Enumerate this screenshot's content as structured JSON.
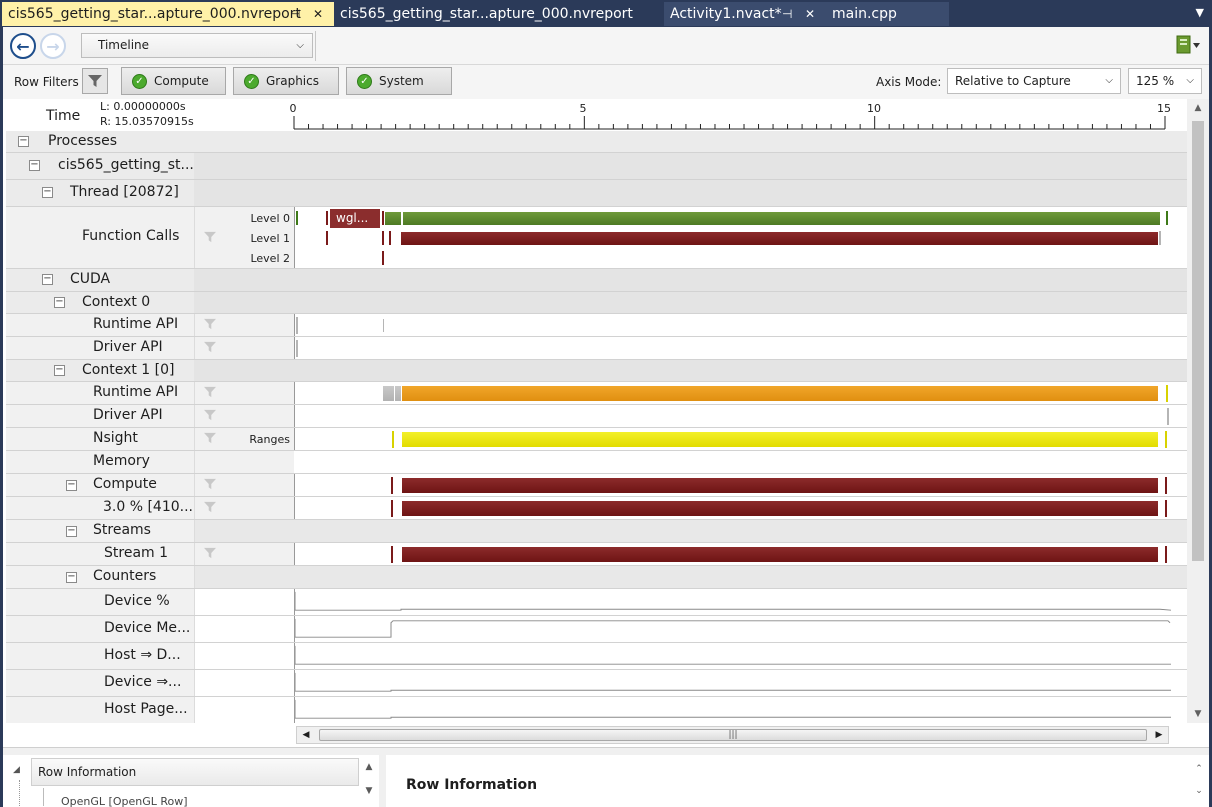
{
  "tabs": [
    {
      "label": "cis565_getting_star...apture_000.nvreport",
      "active": true
    },
    {
      "label": "cis565_getting_star...apture_000.nvreport",
      "active": false
    },
    {
      "label": "Activity1.nvact*",
      "active": false
    },
    {
      "label": "main.cpp",
      "active": false
    }
  ],
  "toolbar": {
    "view_select": "Timeline",
    "back_icon": "back-arrow-icon",
    "forward_icon": "forward-arrow-icon",
    "tool_icon": "export-tool-icon"
  },
  "filters": {
    "label": "Row Filters",
    "buttons": [
      "Compute",
      "Graphics",
      "System"
    ],
    "axis_mode_label": "Axis Mode:",
    "axis_mode": "Relative to Capture",
    "zoom": "125 %"
  },
  "time": {
    "label": "Time",
    "left": "L: 0.00000000s",
    "right": "R: 15.03570915s",
    "ticks": [
      "0",
      "5",
      "10",
      "15"
    ]
  },
  "rows": {
    "processes": "Processes",
    "process": "cis565_getting_st...",
    "thread": "Thread [20872]",
    "function_calls": "Function Calls",
    "level0": "Level 0",
    "level1": "Level 1",
    "level2": "Level 2",
    "wgl": "wgl...",
    "cuda": "CUDA",
    "context0": "Context 0",
    "ctx0_runtime": "Runtime API",
    "ctx0_driver": "Driver API",
    "context1": "Context 1 [0]",
    "ctx1_runtime": "Runtime API",
    "ctx1_driver": "Driver API",
    "nsight": "Nsight",
    "ranges": "Ranges",
    "memory": "Memory",
    "compute": "Compute",
    "compute_kernel": "3.0 % [410...",
    "streams": "Streams",
    "stream1": "Stream 1",
    "counters": "Counters",
    "device_pct": "Device %",
    "device_mem": "Device Me...",
    "host_to_device": "Host ⇒ D...",
    "device_to": "Device ⇒...",
    "host_page": "Host Page..."
  },
  "bottom": {
    "row_info_item": "Row Information",
    "sub_item": "OpenGL [OpenGL Row]",
    "row_info_title": "Row Information"
  },
  "colors": {
    "tab_active": "#fff1a8",
    "frame": "#2b3a59",
    "green_bar": "#5f8a2e",
    "red_bar": "#7c1f1f",
    "orange_bar": "#e8980f",
    "yellow_bar": "#eae500"
  }
}
